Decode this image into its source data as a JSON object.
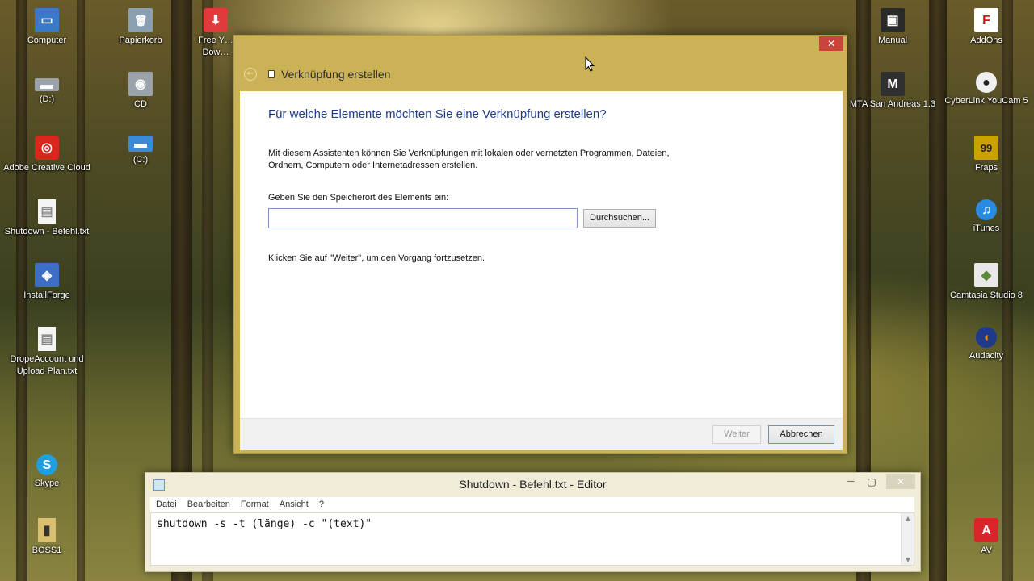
{
  "desktop": {
    "left_icons": [
      {
        "label": "Computer",
        "glyph": "▭",
        "color": "#3a78c8"
      },
      {
        "label": "Papierkorb",
        "glyph": "🗑",
        "color": "#8aa0b0"
      },
      {
        "label": "Free Y… Dow…",
        "glyph": "⬇",
        "color": "#e03a3a"
      },
      {
        "label": "(D:)",
        "glyph": "▬",
        "color": "#9aa3aa"
      },
      {
        "label": "CD",
        "glyph": "◉",
        "color": "#9aa3aa"
      },
      {
        "label": "Adobe Creative Cloud",
        "glyph": "◎",
        "color": "#d8281e"
      },
      {
        "label": "(C:)",
        "glyph": "▬",
        "color": "#3a8ad8"
      },
      {
        "label": "Shutdown - Befehl.txt",
        "glyph": "▤",
        "color": "#f4f4f4"
      },
      {
        "label": "InstallForge",
        "glyph": "◈",
        "color": "#3d6ec4"
      },
      {
        "label": "DropeAccount und Upload Plan.txt",
        "glyph": "▤",
        "color": "#f4f4f4"
      },
      {
        "label": "Skype",
        "glyph": "S",
        "color": "#1ea0e0"
      },
      {
        "label": "BOSS1",
        "glyph": "▮",
        "color": "#d8c070"
      }
    ],
    "right_icons": [
      {
        "label": "Manual",
        "glyph": "▣",
        "color": "#2a2a2a"
      },
      {
        "label": "AddOns",
        "glyph": "F",
        "color": "#d01818"
      },
      {
        "label": "MTA San Andreas 1.3",
        "glyph": "M",
        "color": "#303030"
      },
      {
        "label": "CyberLink YouCam 5",
        "glyph": "●",
        "color": "#202020"
      },
      {
        "label": "Fraps",
        "glyph": "99",
        "color": "#caa200"
      },
      {
        "label": "iTunes",
        "glyph": "♫",
        "color": "#2a8ae0"
      },
      {
        "label": "Camtasia Studio 8",
        "glyph": "◆",
        "color": "#5a8a3a"
      },
      {
        "label": "Audacity",
        "glyph": "◖",
        "color": "#e08a00"
      },
      {
        "label": "AV",
        "glyph": "A",
        "color": "#d8242a"
      }
    ]
  },
  "wizard": {
    "close_glyph": "✕",
    "back_glyph": "←",
    "title": "Verknüpfung erstellen",
    "heading": "Für welche Elemente möchten Sie eine Verknüpfung erstellen?",
    "description": "Mit diesem Assistenten können Sie Verknüpfungen mit lokalen oder vernetzten Programmen, Dateien, Ordnern, Computern oder Internetadressen erstellen.",
    "location_label": "Geben Sie den Speicherort des Elements ein:",
    "location_value": "",
    "browse_button": "Durchsuchen...",
    "hint": "Klicken Sie auf \"Weiter\", um den Vorgang fortzusetzen.",
    "next_button": "Weiter",
    "cancel_button": "Abbrechen"
  },
  "notepad": {
    "title": "Shutdown - Befehl.txt - Editor",
    "minimize": "—",
    "maximize": "▢",
    "close": "✕",
    "menu": [
      "Datei",
      "Bearbeiten",
      "Format",
      "Ansicht",
      "?"
    ],
    "content": "shutdown -s -t (länge) -c \"(text)\"",
    "scroll_up": "▲",
    "scroll_down": "▼"
  }
}
